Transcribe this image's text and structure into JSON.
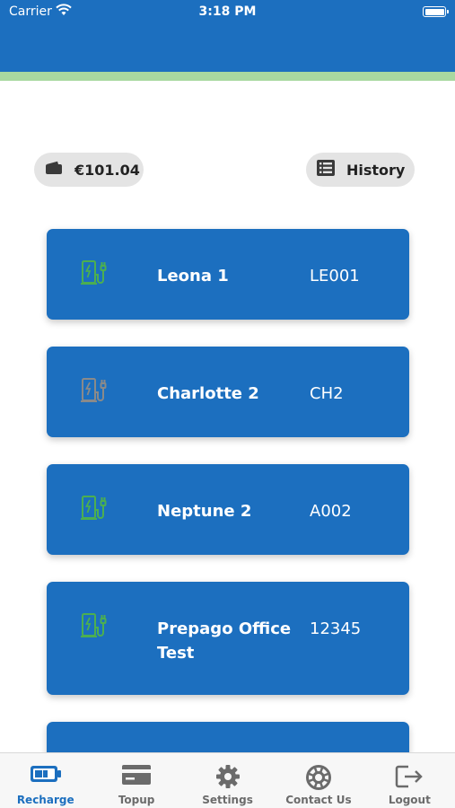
{
  "status_bar": {
    "carrier": "Carrier",
    "time": "3:18 PM"
  },
  "wallet": {
    "balance": "€101.04",
    "history_label": "History"
  },
  "colors": {
    "brand_blue": "#1c6fbf",
    "accent_green": "#a8d8a0",
    "available": "#4caf50",
    "unavailable": "#8a8a8a"
  },
  "chargers": [
    {
      "name": "Leona 1",
      "code": "LE001",
      "status": "available"
    },
    {
      "name": "Charlotte 2",
      "code": "CH2",
      "status": "unavailable"
    },
    {
      "name": "Neptune 2",
      "code": "A002",
      "status": "available"
    },
    {
      "name": "Prepago Office Test",
      "code": "12345",
      "status": "available"
    }
  ],
  "tabs": [
    {
      "label": "Recharge",
      "icon": "battery-icon",
      "active": true
    },
    {
      "label": "Topup",
      "icon": "card-icon",
      "active": false
    },
    {
      "label": "Settings",
      "icon": "gear-icon",
      "active": false
    },
    {
      "label": "Contact Us",
      "icon": "lifebuoy-icon",
      "active": false
    },
    {
      "label": "Logout",
      "icon": "logout-icon",
      "active": false
    }
  ]
}
